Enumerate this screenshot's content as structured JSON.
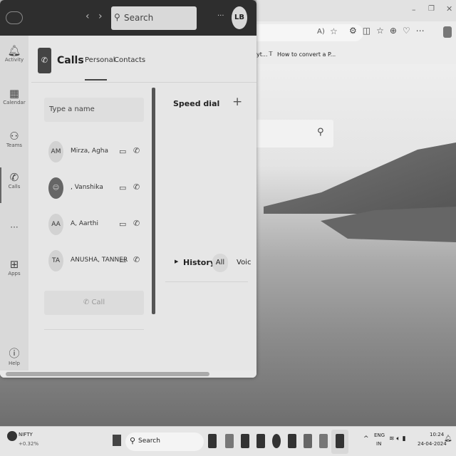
{
  "browser": {
    "bookmark_1": "yt...",
    "bookmark_2": "How to convert a P...",
    "window_controls": [
      "minimize",
      "restore",
      "close"
    ],
    "toolbar_icons": [
      "read-aloud",
      "favorite-star",
      "extensions",
      "split-screen",
      "favorites",
      "collections",
      "performance",
      "more",
      "copilot"
    ]
  },
  "teams": {
    "search_placeholder": "Search",
    "more": "···",
    "avatar_initials": "LB",
    "rail": [
      {
        "label": "Activity",
        "icon": "bell-icon"
      },
      {
        "label": "Calendar",
        "icon": "calendar-icon"
      },
      {
        "label": "Teams",
        "icon": "teams-icon"
      },
      {
        "label": "Calls",
        "icon": "phone-icon"
      },
      {
        "label": "···",
        "icon": "more-icon"
      },
      {
        "label": "Apps",
        "icon": "apps-icon"
      },
      {
        "label": "Help",
        "icon": "help-icon"
      }
    ],
    "calls_title": "Calls",
    "tabs": [
      {
        "label": "Personal",
        "active": true
      },
      {
        "label": "Contacts",
        "active": false
      }
    ],
    "name_placeholder": "Type a name",
    "contacts": [
      {
        "initials": "AM",
        "name": "Mirza, Agha"
      },
      {
        "initials": "",
        "name": ", Vanshika"
      },
      {
        "initials": "AA",
        "name": "A, Aarthi"
      },
      {
        "initials": "TA",
        "name": "ANUSHA, TANNER"
      }
    ],
    "call_button": "Call",
    "speed_dial": "Speed dial",
    "add": "+",
    "history": "History",
    "history_filters": [
      "All",
      "Voic"
    ]
  },
  "taskbar": {
    "widget_name": "NIFTY",
    "widget_value": "+0.32%",
    "search": "Search",
    "lang_1": "ENG",
    "lang_2": "IN",
    "time": "10:24",
    "date": "24-04-2024"
  }
}
